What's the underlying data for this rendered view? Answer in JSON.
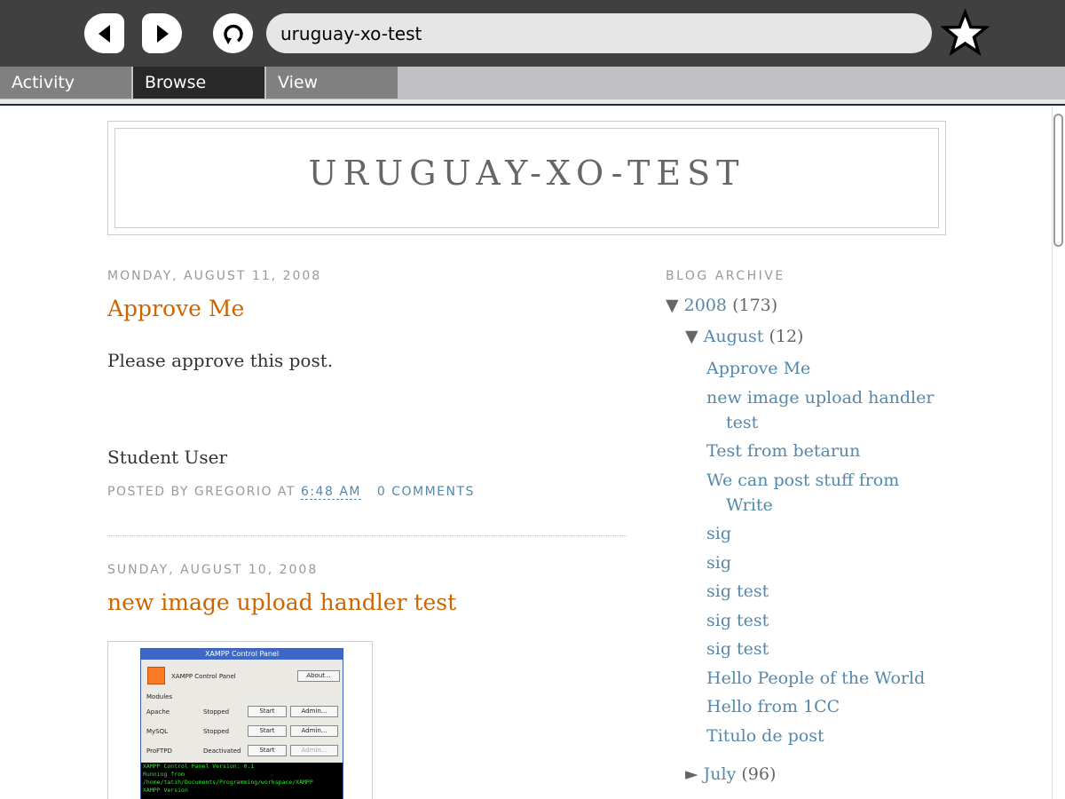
{
  "browser": {
    "url": "uruguay-xo-test",
    "tabs": [
      "Activity",
      "Browse",
      "View"
    ]
  },
  "blog": {
    "title": "URUGUAY-XO-TEST"
  },
  "posts": [
    {
      "date": "MONDAY, AUGUST 11, 2008",
      "title": "Approve Me",
      "body": "Please approve this post.",
      "signature": "Student User",
      "footer_prefix": "POSTED BY GREGORIO AT",
      "time": "6:48 AM",
      "comments": "0 COMMENTS"
    },
    {
      "date": "SUNDAY, AUGUST 10, 2008",
      "title": "new image upload handler test"
    }
  ],
  "xampp": {
    "title": "XAMPP Control Panel",
    "header": "XAMPP Control Panel",
    "about": "About...",
    "modules_label": "Modules",
    "modules": [
      {
        "name": "Apache",
        "status": "Stopped",
        "btn1": "Start",
        "btn2": "Admin..."
      },
      {
        "name": "MySQL",
        "status": "Stopped",
        "btn1": "Start",
        "btn2": "Admin..."
      },
      {
        "name": "ProFTPD",
        "status": "Deactivated",
        "btn1": "Start",
        "btn2": "Admin..."
      }
    ],
    "console": [
      "XAMPP Control Panel Version: 0.1",
      "Running from",
      "/home/tatih/Documents/Programming/workspace/XAMPP",
      "XAMPP Version"
    ]
  },
  "sidebar": {
    "title": "BLOG ARCHIVE",
    "year": {
      "label": "2008",
      "count": "(173)"
    },
    "month": {
      "label": "August",
      "count": "(12)"
    },
    "posts": [
      "Approve Me",
      "new image upload handler test",
      "Test from betarun",
      "We can post stuff from Write",
      "sig",
      "sig",
      "sig test",
      "sig test",
      "sig test",
      "Hello People of the World",
      "Hello from 1CC",
      "Titulo de post"
    ],
    "next_month": {
      "label": "July",
      "count": "(96)"
    }
  },
  "colors": {
    "post_title": "#cc6600",
    "link": "#5588aa",
    "toolbar": "#404040"
  }
}
